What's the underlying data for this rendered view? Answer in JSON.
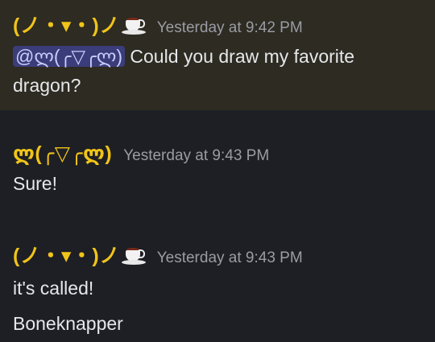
{
  "messages": [
    {
      "author": "(ノ・▾・)ノ",
      "author_icon": "teacup-icon",
      "timestamp": "Yesterday at 9:42 PM",
      "mention": "@ლ(╭▽╭ლ)",
      "line1_rest": " Could you draw my favorite",
      "line2": "dragon?"
    },
    {
      "author": "ლ(╭▽╭ლ)",
      "timestamp": "Yesterday at 9:43 PM",
      "text": "Sure!"
    },
    {
      "author": "(ノ・▾・)ノ",
      "author_icon": "teacup-icon",
      "timestamp": "Yesterday at 9:43 PM",
      "lines": [
        "it's called!",
        "Boneknapper"
      ]
    }
  ],
  "colors": {
    "background": "#1e1f24",
    "highlight_background": "#2d2b22",
    "author_name": "#f0c419",
    "timestamp": "#9a9ca3",
    "message_text": "#e6e7ea",
    "mention_background": "#3b3d7a",
    "mention_text": "#c9cdfb"
  }
}
